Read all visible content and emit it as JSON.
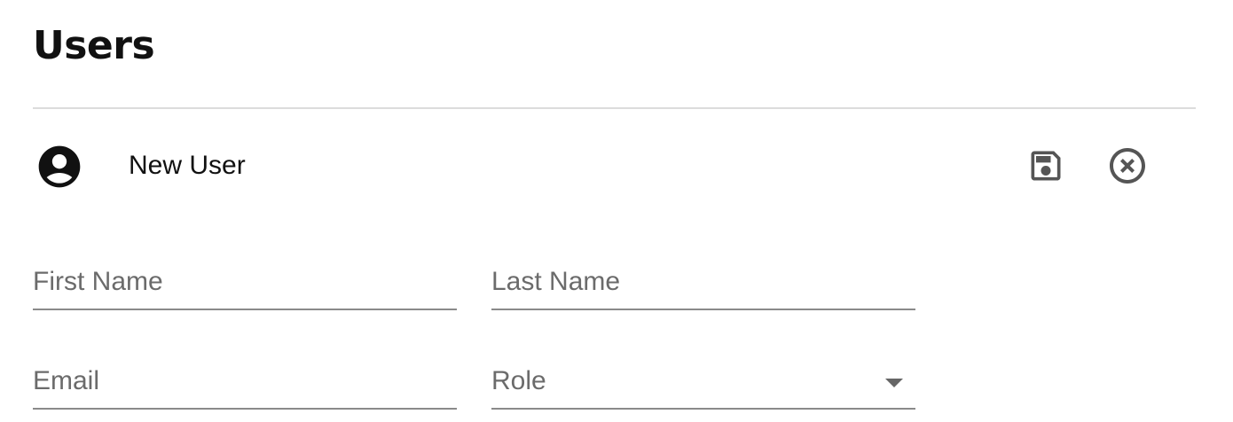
{
  "page": {
    "title": "Users"
  },
  "user_row": {
    "avatar_icon": "account-circle-icon",
    "name": "New User",
    "actions": {
      "save_icon": "floppy-disk-icon",
      "cancel_icon": "cancel-circle-icon"
    }
  },
  "form": {
    "first_name": {
      "placeholder": "First Name",
      "value": ""
    },
    "last_name": {
      "placeholder": "Last Name",
      "value": ""
    },
    "email": {
      "placeholder": "Email",
      "value": ""
    },
    "role": {
      "label": "Role",
      "value": ""
    }
  },
  "colors": {
    "text": "#111111",
    "placeholder": "#6b6b6b",
    "divider": "#dcdcdc",
    "underline": "#8a8a8a",
    "icon": "#555555"
  }
}
